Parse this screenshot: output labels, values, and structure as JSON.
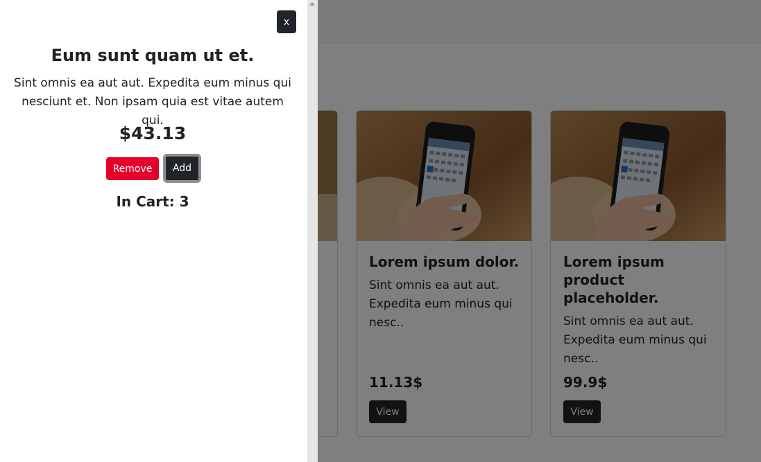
{
  "offcanvas": {
    "close_label": "x",
    "title": "Eum sunt quam ut et.",
    "description": "Sint omnis ea aut aut. Expedita eum minus qui nesciunt et. Non ipsam quia est vitae autem qui.",
    "price": "$43.13",
    "remove_label": "Remove",
    "add_label": "Add",
    "in_cart": "In Cart: 3"
  },
  "products": [
    {
      "title": "Lorem ipsum dolor.",
      "description": "Sint omnis ea aut aut. Expedita eum minus qui nesc..",
      "price": "11.13$",
      "view_label": "View"
    },
    {
      "title": "Lorem ipsum product placeholder.",
      "description": "Sint omnis ea aut aut. Expedita eum minus qui nesc..",
      "price": "99.9$",
      "view_label": "View"
    }
  ],
  "colors": {
    "remove": "#e4002b",
    "dark": "#212529",
    "backdrop": "rgba(0,0,0,0.5)"
  }
}
